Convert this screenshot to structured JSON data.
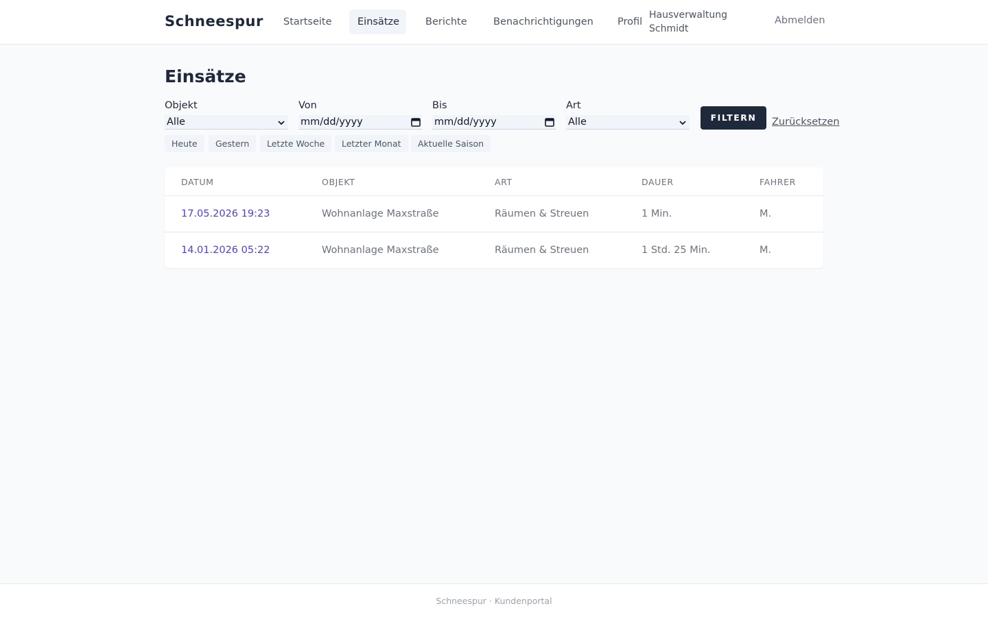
{
  "header": {
    "brand": "Schneespur",
    "nav": [
      {
        "label": "Startseite",
        "active": false
      },
      {
        "label": "Einsätze",
        "active": true
      },
      {
        "label": "Berichte",
        "active": false
      },
      {
        "label": "Benachrichtigungen",
        "active": false
      },
      {
        "label": "Profil",
        "active": false
      }
    ],
    "organization": "Hausverwaltung Schmidt",
    "logout": "Abmelden"
  },
  "page": {
    "title": "Einsätze"
  },
  "filters": {
    "objekt": {
      "label": "Objekt",
      "value": "Alle"
    },
    "von": {
      "label": "Von",
      "value": "mm/dd/yyyy"
    },
    "bis": {
      "label": "Bis",
      "value": "mm/dd/yyyy"
    },
    "art": {
      "label": "Art",
      "value": "Alle"
    },
    "submit": "FILTERN",
    "reset": "Zurücksetzen",
    "quick": [
      "Heute",
      "Gestern",
      "Letzte Woche",
      "Letzter Monat",
      "Aktuelle Saison"
    ]
  },
  "table": {
    "columns": [
      "DATUM",
      "OBJEKT",
      "ART",
      "DAUER",
      "FAHRER"
    ],
    "rows": [
      {
        "datum": "17.05.2026 19:23",
        "objekt": "Wohnanlage Maxstraße",
        "art": "Räumen & Streuen",
        "dauer": "1 Min.",
        "fahrer": "M."
      },
      {
        "datum": "14.01.2026 05:22",
        "objekt": "Wohnanlage Maxstraße",
        "art": "Räumen & Streuen",
        "dauer": "1 Std. 25 Min.",
        "fahrer": "M."
      }
    ]
  },
  "footer": {
    "text": "Schneespur · Kundenportal"
  },
  "colors": {
    "primary": "#1e293b",
    "link": "#4f3fd6",
    "background": "#f8fafc"
  },
  "icons": {
    "select": "chevron-down-icon",
    "date": "calendar-icon"
  }
}
